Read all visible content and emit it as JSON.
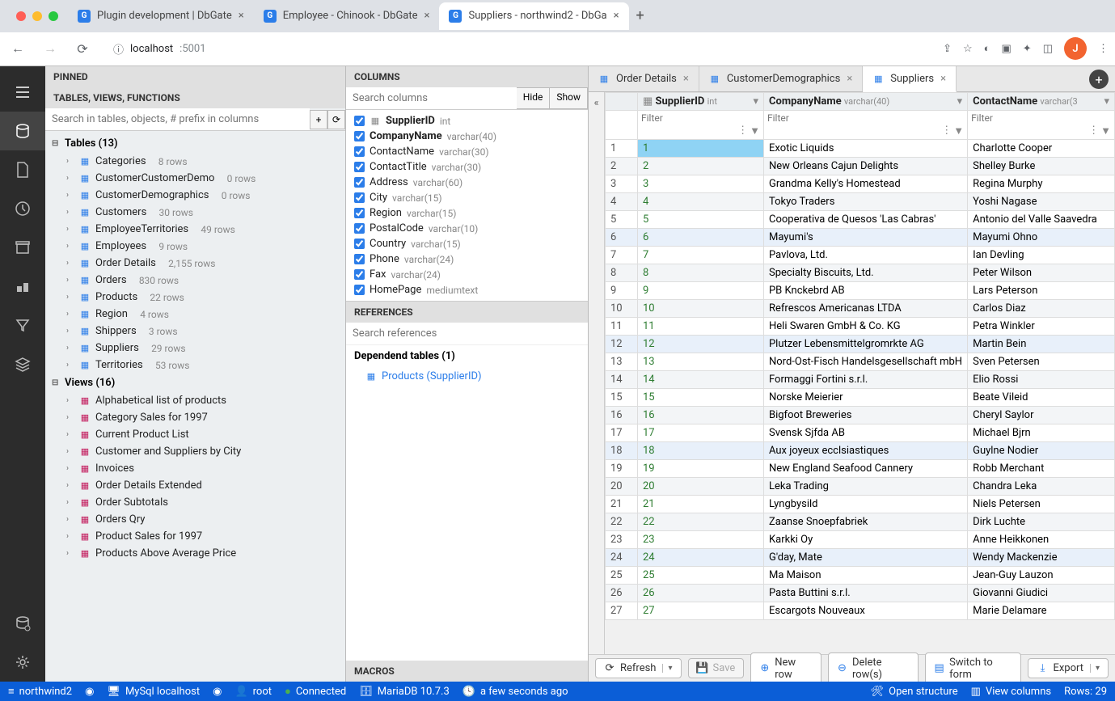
{
  "browser": {
    "tabs": [
      {
        "title": "Plugin development | DbGate",
        "active": false
      },
      {
        "title": "Employee - Chinook - DbGate",
        "active": false
      },
      {
        "title": "Suppliers - northwind2 - DbGa",
        "active": true
      }
    ],
    "url_host": "localhost",
    "url_port": ":5001",
    "avatar_initial": "J"
  },
  "sidebar": {
    "pinned_label": "PINNED",
    "tables_panel_label": "TABLES, VIEWS, FUNCTIONS",
    "search_placeholder": "Search in tables, objects, # prefix in columns",
    "tables_group": "Tables (13)",
    "views_group": "Views (16)",
    "tables": [
      {
        "name": "Categories",
        "rows": "8 rows"
      },
      {
        "name": "CustomerCustomerDemo",
        "rows": "0 rows"
      },
      {
        "name": "CustomerDemographics",
        "rows": "0 rows"
      },
      {
        "name": "Customers",
        "rows": "30 rows"
      },
      {
        "name": "EmployeeTerritories",
        "rows": "49 rows"
      },
      {
        "name": "Employees",
        "rows": "9 rows"
      },
      {
        "name": "Order Details",
        "rows": "2,155 rows"
      },
      {
        "name": "Orders",
        "rows": "830 rows"
      },
      {
        "name": "Products",
        "rows": "22 rows"
      },
      {
        "name": "Region",
        "rows": "4 rows"
      },
      {
        "name": "Shippers",
        "rows": "3 rows"
      },
      {
        "name": "Suppliers",
        "rows": "29 rows"
      },
      {
        "name": "Territories",
        "rows": "53 rows"
      }
    ],
    "views": [
      "Alphabetical list of products",
      "Category Sales for 1997",
      "Current Product List",
      "Customer and Suppliers by City",
      "Invoices",
      "Order Details Extended",
      "Order Subtotals",
      "Orders Qry",
      "Product Sales for 1997",
      "Products Above Average Price"
    ]
  },
  "columns": {
    "header": "COLUMNS",
    "search_placeholder": "Search columns",
    "hide_label": "Hide",
    "show_label": "Show",
    "items": [
      {
        "name": "SupplierID",
        "type": "int",
        "pk": true
      },
      {
        "name": "CompanyName",
        "type": "varchar(40)",
        "bold": true
      },
      {
        "name": "ContactName",
        "type": "varchar(30)"
      },
      {
        "name": "ContactTitle",
        "type": "varchar(30)"
      },
      {
        "name": "Address",
        "type": "varchar(60)"
      },
      {
        "name": "City",
        "type": "varchar(15)"
      },
      {
        "name": "Region",
        "type": "varchar(15)"
      },
      {
        "name": "PostalCode",
        "type": "varchar(10)"
      },
      {
        "name": "Country",
        "type": "varchar(15)"
      },
      {
        "name": "Phone",
        "type": "varchar(24)"
      },
      {
        "name": "Fax",
        "type": "varchar(24)"
      },
      {
        "name": "HomePage",
        "type": "mediumtext"
      }
    ]
  },
  "references": {
    "header": "REFERENCES",
    "search_placeholder": "Search references",
    "dep_header": "Dependend tables (1)",
    "items": [
      "Products (SupplierID)"
    ]
  },
  "macros_header": "MACROS",
  "editor_tabs": [
    {
      "title": "Order Details",
      "active": false
    },
    {
      "title": "CustomerDemographics",
      "active": false
    },
    {
      "title": "Suppliers",
      "active": true
    }
  ],
  "grid": {
    "filter_placeholder": "Filter",
    "columns": [
      {
        "name": "SupplierID",
        "type": "int",
        "pk": true
      },
      {
        "name": "CompanyName",
        "type": "varchar(40)"
      },
      {
        "name": "ContactName",
        "type": "varchar(3"
      }
    ],
    "rows": [
      {
        "n": 1,
        "id": "1",
        "company": "Exotic Liquids",
        "contact": "Charlotte Cooper",
        "sel": true
      },
      {
        "n": 2,
        "id": "2",
        "company": "New Orleans Cajun Delights",
        "contact": "Shelley Burke"
      },
      {
        "n": 3,
        "id": "3",
        "company": "Grandma Kelly's Homestead",
        "contact": "Regina Murphy"
      },
      {
        "n": 4,
        "id": "4",
        "company": "Tokyo Traders",
        "contact": "Yoshi Nagase"
      },
      {
        "n": 5,
        "id": "5",
        "company": "Cooperativa de Quesos 'Las Cabras'",
        "contact": "Antonio del Valle Saavedra"
      },
      {
        "n": 6,
        "id": "6",
        "company": "Mayumi's",
        "contact": "Mayumi Ohno",
        "hl": true
      },
      {
        "n": 7,
        "id": "7",
        "company": "Pavlova, Ltd.",
        "contact": "Ian Devling"
      },
      {
        "n": 8,
        "id": "8",
        "company": "Specialty Biscuits, Ltd.",
        "contact": "Peter Wilson"
      },
      {
        "n": 9,
        "id": "9",
        "company": "PB Knckebrd AB",
        "contact": "Lars Peterson"
      },
      {
        "n": 10,
        "id": "10",
        "company": "Refrescos Americanas LTDA",
        "contact": "Carlos Diaz"
      },
      {
        "n": 11,
        "id": "11",
        "company": "Heli Swaren GmbH & Co. KG",
        "contact": "Petra Winkler"
      },
      {
        "n": 12,
        "id": "12",
        "company": "Plutzer Lebensmittelgromrkte AG",
        "contact": "Martin Bein",
        "hl": true
      },
      {
        "n": 13,
        "id": "13",
        "company": "Nord-Ost-Fisch Handelsgesellschaft mbH",
        "contact": "Sven Petersen"
      },
      {
        "n": 14,
        "id": "14",
        "company": "Formaggi Fortini s.r.l.",
        "contact": "Elio Rossi"
      },
      {
        "n": 15,
        "id": "15",
        "company": "Norske Meierier",
        "contact": "Beate Vileid"
      },
      {
        "n": 16,
        "id": "16",
        "company": "Bigfoot Breweries",
        "contact": "Cheryl Saylor"
      },
      {
        "n": 17,
        "id": "17",
        "company": "Svensk Sjfda AB",
        "contact": "Michael Bjrn"
      },
      {
        "n": 18,
        "id": "18",
        "company": "Aux joyeux ecclsiastiques",
        "contact": "Guylne Nodier",
        "hl": true
      },
      {
        "n": 19,
        "id": "19",
        "company": "New England Seafood Cannery",
        "contact": "Robb Merchant"
      },
      {
        "n": 20,
        "id": "20",
        "company": "Leka Trading",
        "contact": "Chandra Leka"
      },
      {
        "n": 21,
        "id": "21",
        "company": "Lyngbysild",
        "contact": "Niels Petersen"
      },
      {
        "n": 22,
        "id": "22",
        "company": "Zaanse Snoepfabriek",
        "contact": "Dirk Luchte"
      },
      {
        "n": 23,
        "id": "23",
        "company": "Karkki Oy",
        "contact": "Anne Heikkonen"
      },
      {
        "n": 24,
        "id": "24",
        "company": "G'day, Mate",
        "contact": "Wendy Mackenzie",
        "hl": true
      },
      {
        "n": 25,
        "id": "25",
        "company": "Ma Maison",
        "contact": "Jean-Guy Lauzon"
      },
      {
        "n": 26,
        "id": "26",
        "company": "Pasta Buttini s.r.l.",
        "contact": "Giovanni Giudici"
      },
      {
        "n": 27,
        "id": "27",
        "company": "Escargots Nouveaux",
        "contact": "Marie Delamare"
      }
    ]
  },
  "actions": {
    "refresh": "Refresh",
    "save": "Save",
    "new_row": "New row",
    "delete_rows": "Delete row(s)",
    "switch_form": "Switch to form",
    "export": "Export"
  },
  "status": {
    "db": "northwind2",
    "conn": "MySql localhost",
    "user": "root",
    "state": "Connected",
    "server": "MariaDB 10.7.3",
    "last": "a few seconds ago",
    "open_structure": "Open structure",
    "view_columns": "View columns",
    "rows": "Rows: 29"
  }
}
